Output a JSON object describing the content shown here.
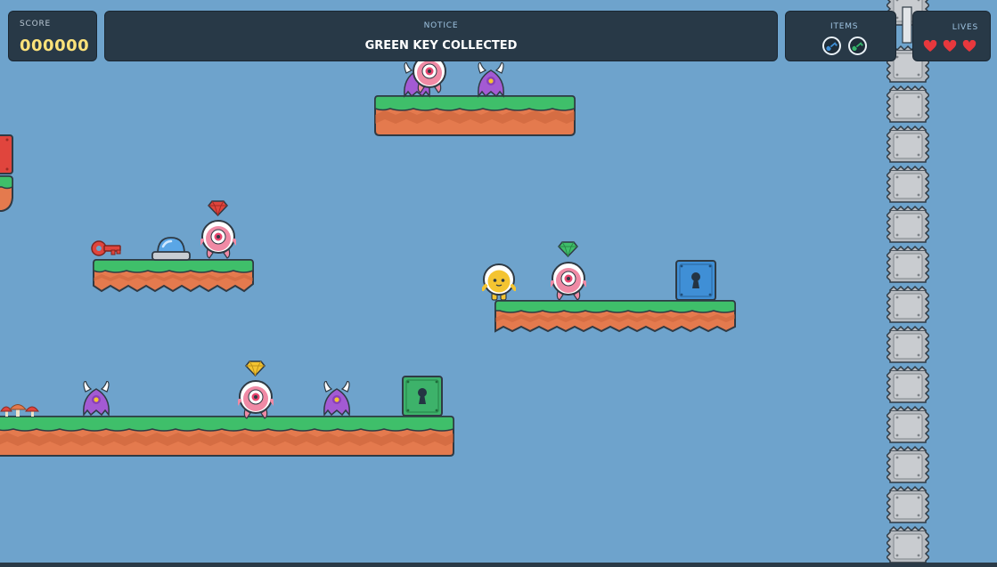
{
  "hud": {
    "score_label": "SCORE",
    "score_value": "000000",
    "notice_label": "NOTICE",
    "notice_text": "GREEN KEY COLLECTED",
    "items_label": "ITEMS",
    "items": [
      {
        "name": "blue-key",
        "color": "#3f8fd6"
      },
      {
        "name": "green-key",
        "color": "#35b36a"
      }
    ],
    "lives_label": "LIVES",
    "lives": 3
  },
  "colors": {
    "sky": "#6ea3cc",
    "grass": "#3fbf6a",
    "dirt": "#e47a4e",
    "gem_red": "#e0453d",
    "gem_green": "#3fbf6a",
    "gem_yellow": "#f4c431",
    "lock_blue": "#3f8fd6",
    "lock_green": "#3db26a"
  },
  "world": {
    "gems": [
      "red",
      "green",
      "yellow"
    ],
    "locks": [
      "blue-lock",
      "green-lock"
    ],
    "enemies": [
      "pink-cyclops",
      "purple-horned-blob"
    ],
    "player": "yellow-astronaut",
    "pickups": [
      "red-key",
      "blue-dome-switch"
    ]
  }
}
